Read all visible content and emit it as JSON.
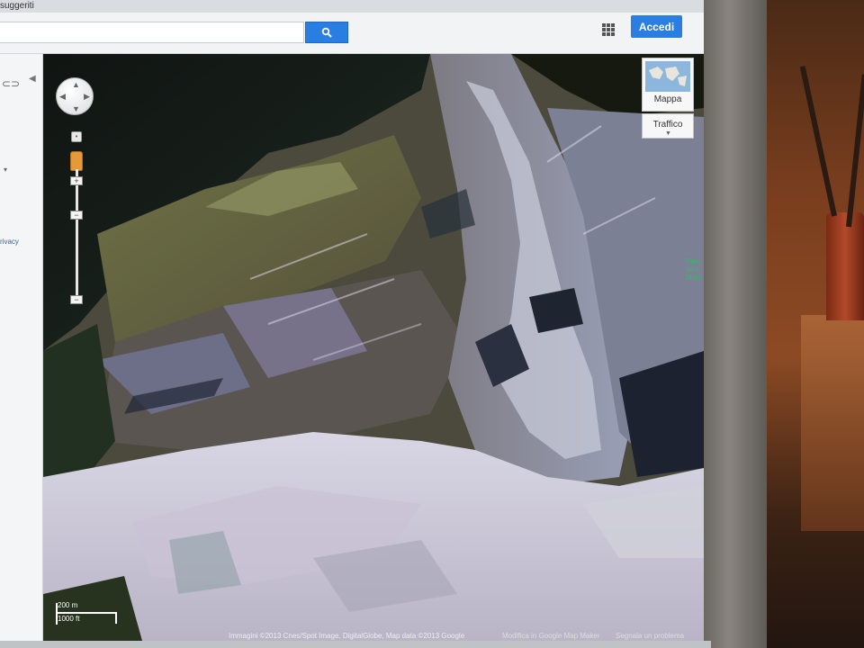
{
  "browser": {
    "top_strip_text": "suggeriti"
  },
  "header": {
    "search_value": "",
    "search_icon": "search-icon",
    "apps_icon": "apps-grid-icon",
    "signin_label": "Accedi",
    "accent_color": "#2a7de1"
  },
  "left_panel": {
    "link_icon": "link-icon",
    "collapse_icon": "collapse-arrow-icon",
    "privacy_text": "rivacy"
  },
  "map": {
    "controls": {
      "zoom_plus": "+",
      "zoom_minus": "−",
      "pan_icon": "pan-control-icon",
      "pegman_icon": "pegman-icon"
    },
    "map_type_label": "Mappa",
    "traffic_label": "Traffico",
    "poi_label": "Parc\nde l\nMon",
    "scale": {
      "metric": "200 m",
      "imperial": "1000 ft"
    },
    "attribution": "Immagini ©2013 Cnes/Spot Image, DigitalGlobe, Map data ©2013 Google",
    "edit_link": "Modifica in Google Map Maker",
    "report_link": "Segnala un problema"
  }
}
